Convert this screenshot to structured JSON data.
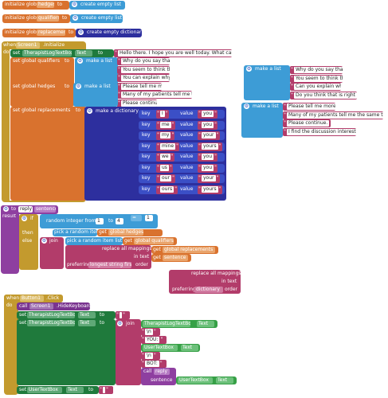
{
  "globals": {
    "hedges_init": {
      "keyword": "initialize global",
      "name": "hedges",
      "to": "to",
      "value": "create empty list"
    },
    "qualifiers_init": {
      "keyword": "initialize global",
      "name": "qualifiers",
      "to": "to",
      "value": "create empty list"
    },
    "replacements_init": {
      "keyword": "initialize global",
      "name": "replacements",
      "to": "to",
      "value": "create empty dictionary"
    }
  },
  "screen_init": {
    "when": "when",
    "component": "Screen1",
    "event": ".Initialize",
    "do": "do",
    "set_keyword": "set",
    "log_component": "TherapistLogTextBox",
    "log_prop": "Text",
    "to": "to",
    "greeting": "Hello there. I hope you are well today. What can ...",
    "set_qualifiers": "set global qualifiers",
    "make_list": "make a list",
    "qualifiers": [
      "Why do you say that",
      "You seem to think that",
      "You can explain why",
      "Please tell me more",
      "Many of my patients tell me the same thing",
      "Please continue."
    ],
    "set_hedges": "set global hedges",
    "set_replacements": "set global replacements",
    "make_dictionary": "make a dictionary",
    "key_label": "key",
    "value_label": "value",
    "pairs": [
      {
        "key": "I",
        "value": "you"
      },
      {
        "key": "me",
        "value": "you"
      },
      {
        "key": "my",
        "value": "your"
      },
      {
        "key": "mine",
        "value": "yours"
      },
      {
        "key": "we",
        "value": "you"
      },
      {
        "key": "us",
        "value": "you"
      },
      {
        "key": "our",
        "value": "your"
      },
      {
        "key": "ours",
        "value": "yours"
      }
    ]
  },
  "floating_lists": {
    "list1": {
      "label": "make a list",
      "items": [
        "Why do you say that",
        "You seem to think that",
        "Can you explain why",
        "Do you think that is right"
      ]
    },
    "list2": {
      "label": "make a list",
      "items": [
        "Please tell me more.",
        "Many of my patients tell me the same thing",
        "Please continue.",
        "I find the discussion interesting"
      ]
    }
  },
  "reply_proc": {
    "to": "to",
    "name": "reply",
    "param": "sentence",
    "result": "result",
    "if": "if",
    "random_int": "random integer from",
    "from": "1",
    "to_val": "4",
    "eq": "=",
    "eq_val": "1",
    "then": "then",
    "pick_random": "pick a random item list",
    "get": "get",
    "hedges_var": "global hedges",
    "else": "else",
    "join": "join",
    "qualifiers_var": "global qualifiers",
    "replace_all": "replace all mappings",
    "in_text": "in text",
    "replacements_var": "global replacements",
    "sentence_var": "sentence",
    "preferring": "preferring",
    "longest_first": "longest string first",
    "order": "order"
  },
  "floating_replace": {
    "replace_all": "replace all mappings",
    "in_text": "in text",
    "preferring": "preferring",
    "dictionary_order": "dictionary",
    "order": "order"
  },
  "button_click": {
    "when": "when",
    "component": "Button1",
    "event": ".Click",
    "do": "do",
    "call": "call",
    "screen": "Screen1",
    "hide_kb": ".HideKeyboard",
    "set": "set",
    "log_component": "TherapistLogTextBox",
    "text_prop": "Text",
    "to": "to",
    "join": "join",
    "nl": "\\n",
    "you_label": "YOU:",
    "user_box": "UserTextBox",
    "bot_label": "BOT:",
    "call_reply": "call",
    "reply": "reply",
    "sentence": "sentence",
    "empty": ""
  },
  "colors": {
    "orange": "#d9722e",
    "lightblue": "#3d9cd6",
    "blue": "#3b4fc6",
    "pink": "#b23c6a",
    "gold": "#c39a2e",
    "purple": "#8e3fa0",
    "green": "#1f7a3c"
  }
}
